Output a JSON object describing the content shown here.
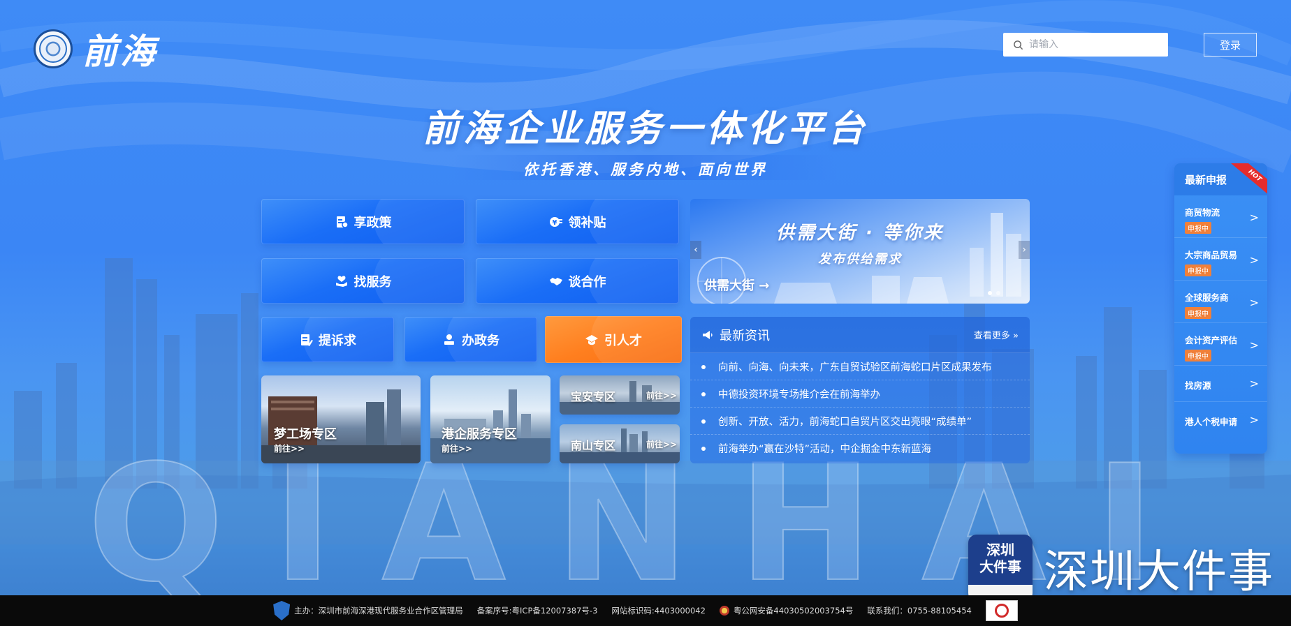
{
  "header": {
    "logo_text": "前海",
    "search_placeholder": "请输入",
    "login_label": "登录"
  },
  "hero": {
    "title": "前海企业服务一体化平台",
    "subtitle": "依托香港、服务内地、面向世界"
  },
  "services": {
    "policy": "享政策",
    "subsidy": "领补贴",
    "find_service": "找服务",
    "cooperation": "谈合作",
    "appeal": "提诉求",
    "affairs": "办政务",
    "talent": "引人才"
  },
  "zones": {
    "dream": {
      "title": "梦工场专区",
      "go": "前往>>"
    },
    "hk": {
      "title": "港企服务专区",
      "go": "前往>>"
    },
    "baoan": {
      "title": "宝安专区",
      "go": "前往>>"
    },
    "nanshan": {
      "title": "南山专区",
      "go": "前往>>"
    }
  },
  "banner": {
    "title": "供需大街 · 等你来",
    "subtitle": "发布供给需求",
    "tag": "供需大街 →"
  },
  "news": {
    "title": "最新资讯",
    "more": "查看更多 »",
    "items": [
      "向前、向海、向未来，广东自贸试验区前海蛇口片区成果发布",
      "中德投资环境专场推介会在前海举办",
      "创新、开放、活力，前海蛇口自贸片区交出亮眼“成绩单”",
      "前海举办“赢在沙特”活动，中企掘金中东新蓝海"
    ]
  },
  "side": {
    "title": "最新申报",
    "hot": "HOT",
    "items": [
      {
        "label": "商贸物流",
        "badge": "申报中",
        "arrow": ">"
      },
      {
        "label": "大宗商品贸易",
        "badge": "申报中",
        "arrow": ">"
      },
      {
        "label": "全球服务商",
        "badge": "申报中",
        "arrow": ">"
      },
      {
        "label": "会计资产评估",
        "badge": "申报中",
        "arrow": ">"
      }
    ],
    "links": [
      {
        "label": "找房源",
        "arrow": ">"
      },
      {
        "label": "港人个税申请",
        "arrow": ">"
      }
    ]
  },
  "watermark": {
    "badge_line1": "深圳",
    "badge_line2": "大件事",
    "text": "深圳大件事"
  },
  "footer": {
    "sponsor": "主办：深圳市前海深港现代服务业合作区管理局",
    "icp": "备案序号:粤ICP备12007387号-3",
    "site_code": "网站标识码:4403000042",
    "security": "粤公网安备44030502003754号",
    "contact": "联系我们：0755-88105454"
  },
  "background_letters": "QIANHAI"
}
